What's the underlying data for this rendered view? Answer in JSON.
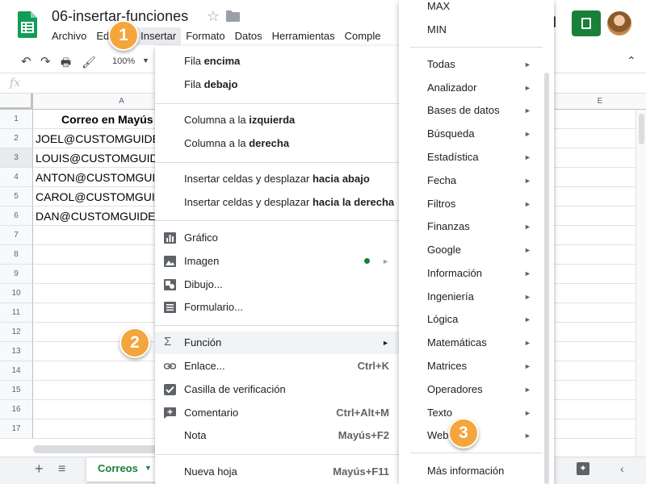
{
  "header": {
    "doc_title": "06-insertar-funciones",
    "menus": [
      "Archivo",
      "Edi",
      "",
      "Insertar",
      "Formato",
      "Datos",
      "Herramientas",
      "Comple"
    ]
  },
  "toolbar": {
    "zoom": "100%"
  },
  "grid": {
    "col_a": "A",
    "col_e": "E",
    "rows": [
      "1",
      "2",
      "3",
      "4",
      "5",
      "6",
      "7",
      "8",
      "9",
      "10",
      "11",
      "12",
      "13",
      "14",
      "15",
      "16",
      "17"
    ],
    "cells": [
      "Correo en Mayús",
      "JOEL@CUSTOMGUIDE",
      "LOUIS@CUSTOMGUIDE",
      "ANTON@CUSTOMGUIDE",
      "CAROL@CUSTOMGUIDE",
      "DAN@CUSTOMGUIDE"
    ]
  },
  "sheet_bar": {
    "tab_label": "Correos"
  },
  "insert_menu": {
    "fila_encima": {
      "prefix": "Fila ",
      "bold": "encima"
    },
    "fila_debajo": {
      "prefix": "Fila ",
      "bold": "debajo"
    },
    "columna_izquierda": {
      "prefix": "Columna a la ",
      "bold": "izquierda"
    },
    "columna_derecha": {
      "prefix": "Columna a la ",
      "bold": "derecha"
    },
    "celdas_abajo": {
      "prefix": "Insertar celdas y desplazar ",
      "bold": "hacia abajo"
    },
    "celdas_derecha": {
      "prefix": "Insertar celdas y desplazar ",
      "bold": "hacia la derecha"
    },
    "grafico": "Gráfico",
    "imagen": "Imagen",
    "dibujo": "Dibujo...",
    "formulario": "Formulario...",
    "funcion": "Función",
    "enlace": "Enlace...",
    "enlace_shortcut": "Ctrl+K",
    "casilla": "Casilla de verificación",
    "comentario": "Comentario",
    "comentario_shortcut": "Ctrl+Alt+M",
    "nota": "Nota",
    "nota_shortcut": "Mayús+F2",
    "nueva_hoja": "Nueva hoja",
    "nueva_hoja_shortcut": "Mayús+F11"
  },
  "function_menu": {
    "top": [
      "MAX",
      "MIN"
    ],
    "categories": [
      "Todas",
      "Analizador",
      "Bases de datos",
      "Búsqueda",
      "Estadística",
      "Fecha",
      "Filtros",
      "Finanzas",
      "Google",
      "Información",
      "Ingeniería",
      "Lógica",
      "Matemáticas",
      "Matrices",
      "Operadores",
      "Texto",
      "Web"
    ],
    "more_info": "Más información"
  },
  "callouts": [
    "1",
    "2",
    "3"
  ],
  "colors": {
    "brand_green": "#188038",
    "callout_orange": "#f4a53b"
  }
}
